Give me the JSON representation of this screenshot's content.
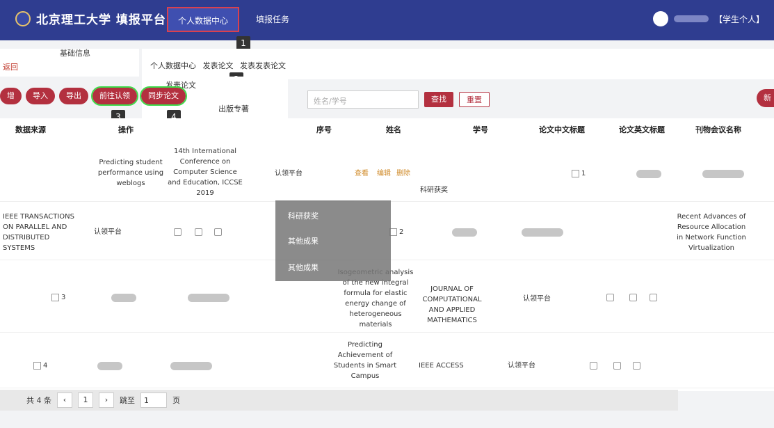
{
  "header": {
    "logo_text": "北京理工大学 填报平台",
    "tab_active": "个人数据中心",
    "tab_2": "填报任务",
    "user_role": "【学生个人】"
  },
  "badges": [
    "1",
    "2",
    "3",
    "4"
  ],
  "back_label": "返回",
  "side_menu": [
    "基础信息"
  ],
  "breadcrumb": [
    "个人数据中心",
    "发表论文",
    "发表发表论文"
  ],
  "tree": {
    "item1": "发表论文",
    "item2": "出版专著",
    "item3": "科研获奖"
  },
  "toolbar": [
    "增",
    "导入",
    "导出",
    "前往认领",
    "同步论文"
  ],
  "search": {
    "placeholder": "姓名/学号",
    "find": "查找",
    "reset": "重置",
    "new": "新"
  },
  "columns": [
    "序号",
    "姓名",
    "学号",
    "论文中文标题",
    "论文英文标题",
    "刊物会议名称",
    "数据来源",
    "操作"
  ],
  "rows": [
    {
      "no": "1",
      "en_title": "Predicting student performance using weblogs",
      "journal": "14th International Conference on Computer Science and Education, ICCSE 2019",
      "source": "认领平台",
      "ops": [
        "查看",
        "编辑",
        "删除"
      ]
    },
    {
      "no": "2",
      "en_title": "Recent Advances of Resource Allocation in Network Function Virtualization",
      "journal": "IEEE TRANSACTIONS ON PARALLEL AND DISTRIBUTED SYSTEMS",
      "source": "认领平台"
    },
    {
      "no": "3",
      "en_title": "Isogeometric analysis of the new integral formula for elastic energy change of heterogeneous materials",
      "journal": "JOURNAL OF COMPUTATIONAL AND APPLIED MATHEMATICS",
      "source": "认领平台"
    },
    {
      "no": "4",
      "en_title": "Predicting Achievement of Students in Smart Campus",
      "journal": "IEEE ACCESS",
      "source": "认领平台"
    }
  ],
  "overlay": [
    "科研获奖",
    "其他成果",
    "其他成果"
  ],
  "pager": {
    "total": "共 4 条",
    "page": "1",
    "goto": "跳至",
    "input": "1",
    "unit": "页"
  }
}
